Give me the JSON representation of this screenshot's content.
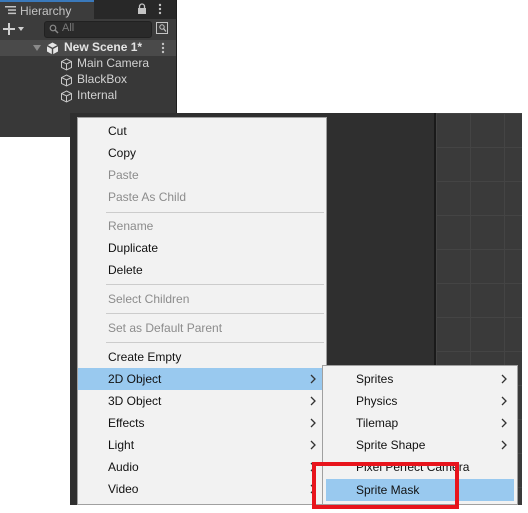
{
  "hierarchy": {
    "tab_label": "Hierarchy",
    "search_placeholder": "All",
    "scene_name": "New Scene 1*",
    "game_objects": [
      "Main Camera",
      "BlackBox",
      "Internal"
    ]
  },
  "context_menu": {
    "items": [
      {
        "label": "Cut",
        "disabled": false
      },
      {
        "label": "Copy",
        "disabled": false
      },
      {
        "label": "Paste",
        "disabled": true
      },
      {
        "label": "Paste As Child",
        "disabled": true
      },
      {
        "label": "Rename",
        "disabled": true
      },
      {
        "label": "Duplicate",
        "disabled": false
      },
      {
        "label": "Delete",
        "disabled": false
      },
      {
        "label": "Select Children",
        "disabled": true
      },
      {
        "label": "Set as Default Parent",
        "disabled": true
      },
      {
        "label": "Create Empty",
        "disabled": false
      },
      {
        "label": "2D Object",
        "disabled": false,
        "selected": true,
        "submenu": true
      },
      {
        "label": "3D Object",
        "disabled": false,
        "submenu": true
      },
      {
        "label": "Effects",
        "disabled": false,
        "submenu": true
      },
      {
        "label": "Light",
        "disabled": false,
        "submenu": true
      },
      {
        "label": "Audio",
        "disabled": false,
        "submenu": true
      },
      {
        "label": "Video",
        "disabled": false,
        "submenu": true
      }
    ]
  },
  "submenu_2d": {
    "items": [
      {
        "label": "Sprites",
        "submenu": true
      },
      {
        "label": "Physics",
        "submenu": true
      },
      {
        "label": "Tilemap",
        "submenu": true
      },
      {
        "label": "Sprite Shape",
        "submenu": true
      },
      {
        "label": "Pixel Perfect Camera",
        "submenu": false
      },
      {
        "label": "Sprite Mask",
        "submenu": false,
        "selected": true
      }
    ]
  },
  "colors": {
    "menu_selection": "#99c9ef",
    "annotation_box": "#e8141c",
    "editor_dark": "#383838"
  }
}
